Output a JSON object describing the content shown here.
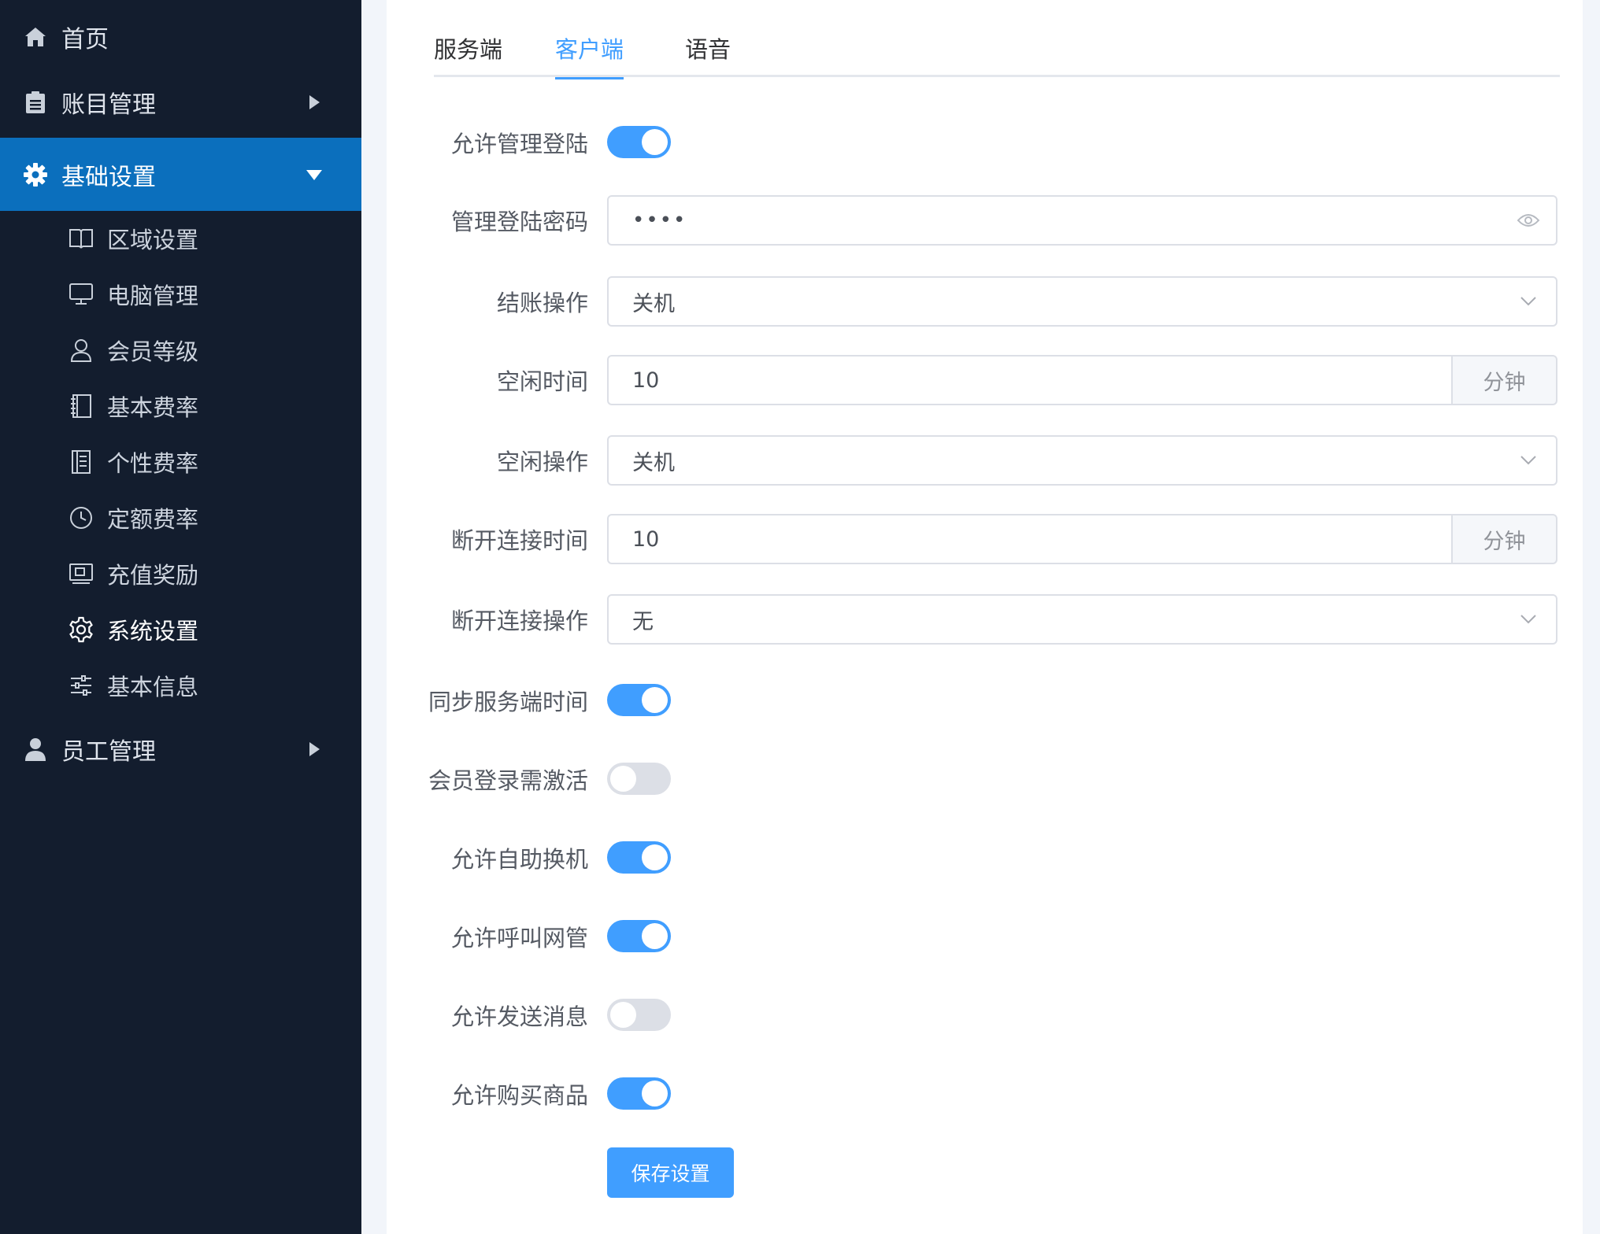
{
  "sidebar": {
    "home": {
      "label": "首页",
      "icon": "home-icon"
    },
    "accounts": {
      "label": "账目管理",
      "icon": "clipboard-icon"
    },
    "basic_settings": {
      "label": "基础设置",
      "icon": "gear-icon"
    },
    "sub_items": [
      {
        "label": "区域设置",
        "icon": "book-open-icon"
      },
      {
        "label": "电脑管理",
        "icon": "monitor-icon"
      },
      {
        "label": "会员等级",
        "icon": "user-icon"
      },
      {
        "label": "基本费率",
        "icon": "notebook-icon"
      },
      {
        "label": "个性费率",
        "icon": "document-icon"
      },
      {
        "label": "定额费率",
        "icon": "clock-icon"
      },
      {
        "label": "充值奖励",
        "icon": "gift-card-icon"
      },
      {
        "label": "系统设置",
        "icon": "cog-icon"
      },
      {
        "label": "基本信息",
        "icon": "sliders-icon"
      }
    ],
    "staff": {
      "label": "员工管理",
      "icon": "person-icon"
    }
  },
  "tabs": [
    {
      "label": "服务端"
    },
    {
      "label": "客户端"
    },
    {
      "label": "语音"
    }
  ],
  "form": {
    "allow_admin_login": {
      "label": "允许管理登陆",
      "on": true
    },
    "admin_password": {
      "label": "管理登陆密码",
      "value": "••••"
    },
    "checkout_action": {
      "label": "结账操作",
      "value": "关机"
    },
    "idle_time": {
      "label": "空闲时间",
      "value": "10",
      "unit": "分钟"
    },
    "idle_action": {
      "label": "空闲操作",
      "value": "关机"
    },
    "disconnect_time": {
      "label": "断开连接时间",
      "value": "10",
      "unit": "分钟"
    },
    "disconnect_action": {
      "label": "断开连接操作",
      "value": "无"
    },
    "sync_server_time": {
      "label": "同步服务端时间",
      "on": true
    },
    "member_login_activation": {
      "label": "会员登录需激活",
      "on": false
    },
    "allow_self_switch": {
      "label": "允许自助换机",
      "on": true
    },
    "allow_call_admin": {
      "label": "允许呼叫网管",
      "on": true
    },
    "allow_send_message": {
      "label": "允许发送消息",
      "on": false
    },
    "allow_buy_goods": {
      "label": "允许购买商品",
      "on": true
    },
    "save_label": "保存设置"
  },
  "colors": {
    "accent": "#409eff",
    "sidebar_bg": "#131d2e",
    "sidebar_active": "#0b6fbd"
  }
}
